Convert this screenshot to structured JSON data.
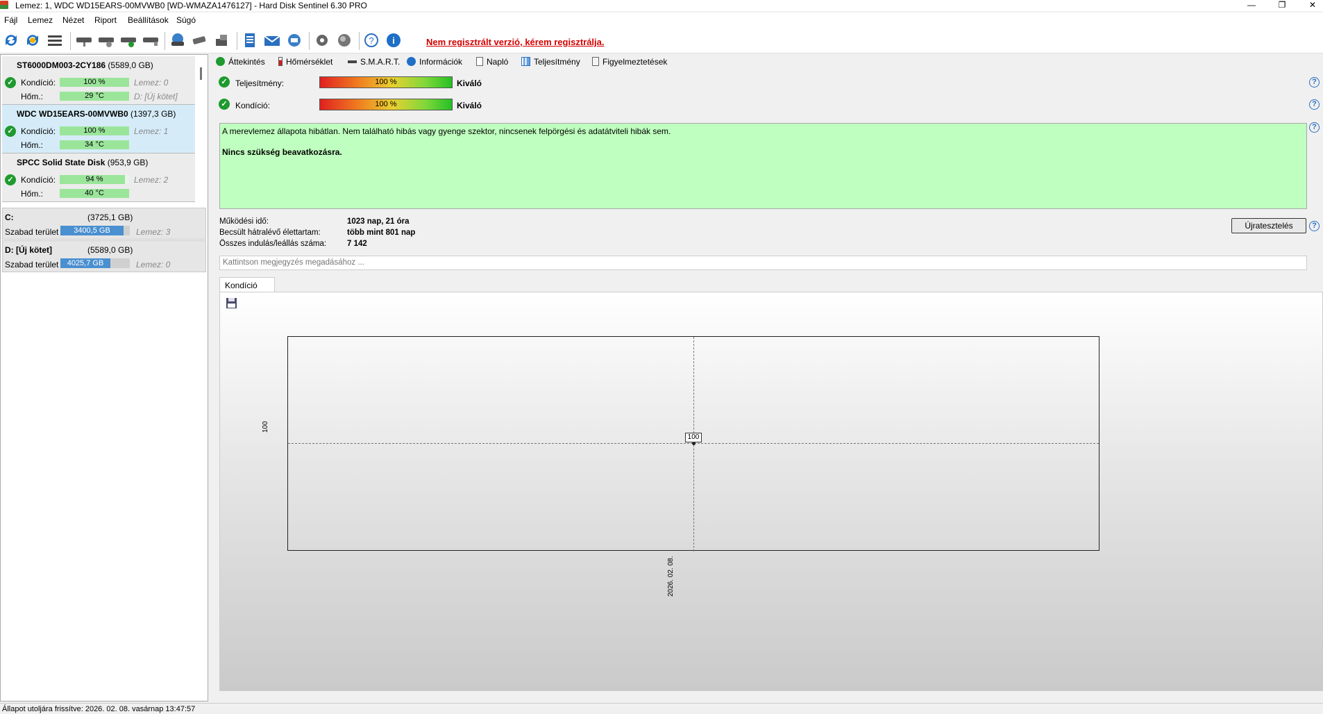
{
  "window": {
    "title": "Lemez: 1, WDC WD15EARS-00MVWB0 [WD-WMAZA1476127] - Hard Disk Sentinel 6.30 PRO",
    "minimize": "—",
    "restore": "❐",
    "close": "✕"
  },
  "menu": [
    "Fájl",
    "Lemez",
    "Nézet",
    "Riport",
    "Beállítások",
    "Súgó"
  ],
  "toolbar": {
    "register_text": "Nem regisztrált verzió, kérem regisztrálja."
  },
  "disks": [
    {
      "name": "ST6000DM003-2CY186",
      "size": "(5589,0 GB)",
      "condition_label": "Kondíció:",
      "condition": "100 %",
      "condition_pct": 100,
      "temp_label": "Hőm.:",
      "temp": "29 °C",
      "disk_index": "Lemez: 0",
      "volume": "D: [Új kötet]"
    },
    {
      "name": "WDC WD15EARS-00MVWB0",
      "size": "(1397,3 GB)",
      "condition_label": "Kondíció:",
      "condition": "100 %",
      "condition_pct": 100,
      "temp_label": "Hőm.:",
      "temp": "34 °C",
      "disk_index": "Lemez: 1",
      "volume": ""
    },
    {
      "name": "SPCC Solid State Disk",
      "size": "(953,9 GB)",
      "condition_label": "Kondíció:",
      "condition": "94 %",
      "condition_pct": 94,
      "temp_label": "Hőm.:",
      "temp": "40 °C",
      "disk_index": "Lemez: 2",
      "volume": ""
    }
  ],
  "volumes": [
    {
      "name": "C:",
      "size": "(3725,1 GB)",
      "free_label": "Szabad terület",
      "free": "3400,5 GB",
      "free_pct": 91,
      "disk_index": "Lemez: 3"
    },
    {
      "name": "D: [Új kötet]",
      "size": "(5589,0 GB)",
      "free_label": "Szabad terület",
      "free": "4025,7 GB",
      "free_pct": 72,
      "disk_index": "Lemez: 0"
    }
  ],
  "tabs": [
    "Áttekintés",
    "Hőmérséklet",
    "S.M.A.R.T.",
    "Információk",
    "Napló",
    "Teljesítmény",
    "Figyelmeztetések"
  ],
  "overview": {
    "performance_label": "Teljesítmény:",
    "performance_value": "100 %",
    "performance_result": "Kiváló",
    "condition_label": "Kondíció:",
    "condition_value": "100 %",
    "condition_result": "Kiváló",
    "status_text": "A merevlemez állapota hibátlan. Nem található hibás vagy gyenge szektor, nincsenek felpörgési és adatátviteli hibák sem.",
    "status_action": "Nincs szükség beavatkozásra.",
    "uptime_label": "Működési idő:",
    "uptime_value": "1023 nap, 21 óra",
    "lifetime_label": "Becsült hátralévő élettartam:",
    "lifetime_value": "több mint 801 nap",
    "startstop_label": "Összes indulás/leállás száma:",
    "startstop_value": "7 142",
    "retest_button": "Újratesztelés",
    "note_placeholder": "Kattintson megjegyzés megadásához ..."
  },
  "chart_tab": "Kondíció  (%)",
  "chart_data": {
    "type": "line",
    "x": [
      "2026. 02. 08."
    ],
    "series": [
      {
        "name": "Kondíció",
        "values": [
          100
        ]
      }
    ],
    "ytick": "100",
    "xtick": "2026. 02. 08.",
    "point_label": "100"
  },
  "statusbar": "Állapot utoljára frissítve: 2026. 02. 08. vasárnap 13:47:57"
}
